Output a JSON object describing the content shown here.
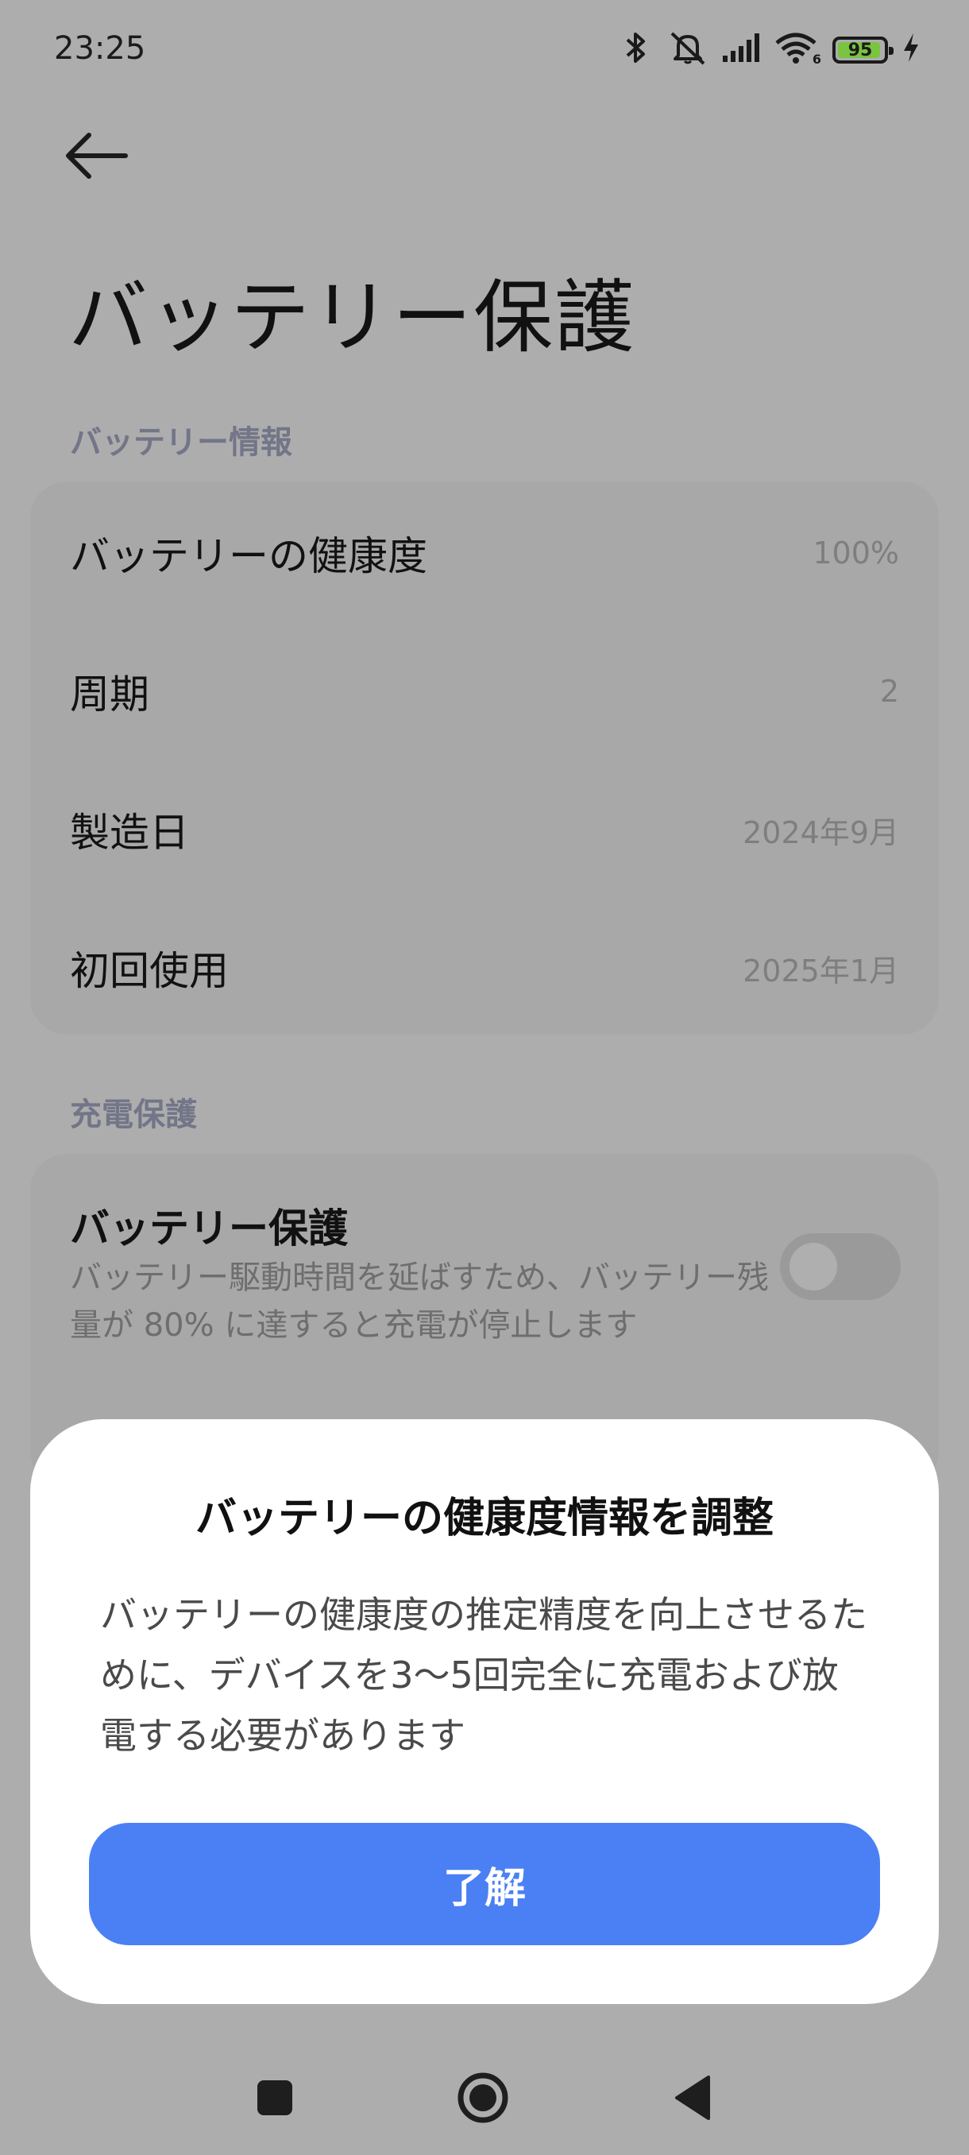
{
  "status_bar": {
    "time": "23:25",
    "battery_level": "95",
    "battery_percent": 95,
    "icons": [
      "bluetooth-icon",
      "mute-icon",
      "signal-icon",
      "wifi-icon",
      "battery-icon",
      "charging-icon"
    ],
    "wifi_badge": "6"
  },
  "header": {
    "back_icon": "back-arrow-icon",
    "title": "バッテリー保護"
  },
  "battery_info": {
    "section_title": "バッテリー情報",
    "rows": [
      {
        "label": "バッテリーの健康度",
        "value": "100%"
      },
      {
        "label": "周期",
        "value": "2"
      },
      {
        "label": "製造日",
        "value": "2024年9月"
      },
      {
        "label": "初回使用",
        "value": "2025年1月"
      }
    ]
  },
  "charging_protection": {
    "section_title": "充電保護",
    "item": {
      "title": "バッテリー保護",
      "description": "バッテリー駆動時間を延ばすため、バッテリー残量が 80% に達すると充電が停止します",
      "enabled": false
    }
  },
  "dialog": {
    "title": "バッテリーの健康度情報を調整",
    "message": "バッテリーの健康度の推定精度を向上させるために、デバイスを3〜5回完全に充電および放電する必要があります",
    "ok_label": "了解"
  },
  "nav_bar": {
    "icons": [
      "recents-square-icon",
      "home-circle-icon",
      "back-triangle-icon"
    ]
  },
  "colors": {
    "accent": "#4b80f4",
    "scrim": "#adadad",
    "battery_fill": "#7ac441"
  }
}
